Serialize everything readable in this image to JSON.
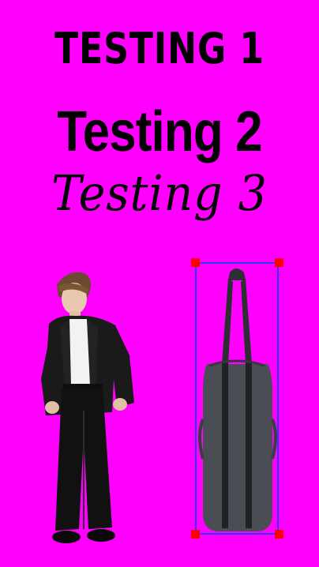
{
  "canvas": {
    "background": "#ff00ff"
  },
  "texts": {
    "line1": "TESTING 1",
    "line2": "Testing 2",
    "line3": "Testing 3"
  },
  "selection": {
    "border_color": "#2a3bff",
    "handle_color": "#ff0000"
  },
  "icons": {
    "person": "person-image",
    "bag": "bag-image"
  }
}
